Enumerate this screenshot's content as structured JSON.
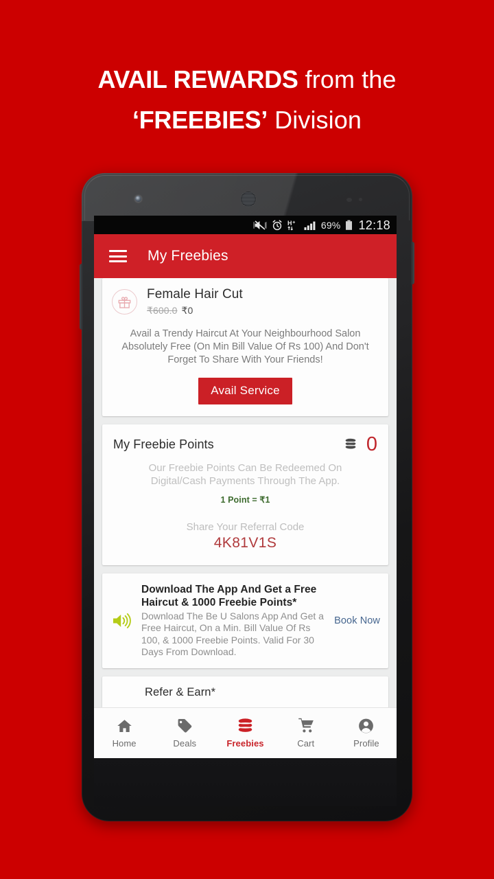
{
  "headline": {
    "line1_bold": "AVAIL REWARDS",
    "line1_rest": " from the",
    "line2_bold": "‘FREEBIES’",
    "line2_rest": " Division"
  },
  "colors": {
    "background_red": "#cc0000",
    "appbar_red": "#cf2027",
    "button_red": "#cb2026",
    "accent_red": "#c0272d",
    "code_red": "#b03a3c",
    "green": "#3d6b2e",
    "link_blue": "#46668f",
    "speaker_green": "#b5cc18"
  },
  "statusbar": {
    "icons": [
      "vibrate-mute-icon",
      "alarm-clock-icon",
      "hplus-data-icon",
      "signal-bars-icon"
    ],
    "battery_percent": "69%",
    "battery_icon": "battery-icon",
    "clock": "12:18"
  },
  "appbar": {
    "menu_icon": "hamburger-menu-icon",
    "title": "My Freebies"
  },
  "freebie_card": {
    "icon": "gift-icon",
    "title": "Female Hair Cut",
    "price_old": "₹600.0",
    "price_new": "₹0",
    "description": "Avail a Trendy Haircut At Your Neighbourhood Salon Absolutely Free (On Min Bill Value Of Rs 100) And Don't Forget To Share With Your Friends!",
    "button_label": "Avail Service"
  },
  "points_card": {
    "title": "My Freebie Points",
    "coins_icon": "coins-stack-icon",
    "points_value": "0",
    "description": "Our Freebie Points Can Be Redeemed On Digital/Cash Payments Through The App.",
    "rate": "1 Point = ₹1",
    "referral_label": "Share Your Referral Code",
    "referral_code": "4K81V1S"
  },
  "promo_card": {
    "icon": "announcement-speaker-icon",
    "title": "Download The App And Get a Free Haircut & 1000 Freebie Points*",
    "description": "Download The Be U Salons App And Get a Free Haircut, On a Min. Bill Value Of Rs 100, & 1000 Freebie Points. Valid For 30 Days From Download.",
    "cta_label": "Book Now"
  },
  "refer_card": {
    "title": "Refer & Earn*"
  },
  "bottomnav": {
    "items": [
      {
        "label": "Home",
        "icon": "home-icon",
        "active": false
      },
      {
        "label": "Deals",
        "icon": "tag-icon",
        "active": false
      },
      {
        "label": "Freebies",
        "icon": "coins-icon",
        "active": true
      },
      {
        "label": "Cart",
        "icon": "cart-icon",
        "active": false
      },
      {
        "label": "Profile",
        "icon": "person-icon",
        "active": false
      }
    ]
  }
}
